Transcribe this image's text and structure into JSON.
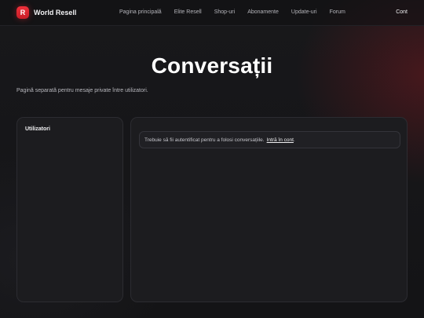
{
  "app": {
    "logo_letter": "R",
    "name": "World Resell"
  },
  "nav": {
    "items": [
      {
        "label": "Pagina principală"
      },
      {
        "label": "Elite Resell"
      },
      {
        "label": "Shop-uri"
      },
      {
        "label": "Abonamente"
      },
      {
        "label": "Update-uri"
      },
      {
        "label": "Forum"
      }
    ],
    "account_label": "Cont"
  },
  "page": {
    "title": "Conversații",
    "subtitle": "Pagină separată pentru mesaje private între utilizatori."
  },
  "users_panel": {
    "heading": "Utilizatori"
  },
  "chat_panel": {
    "notice_text": "Trebuie să fii autentificat pentru a folosi conversațiile.",
    "login_link": "Intră în cont",
    "notice_suffix": "."
  },
  "colors": {
    "accent": "#e8262f",
    "background": "#151517",
    "panel": "#1c1c1f"
  }
}
